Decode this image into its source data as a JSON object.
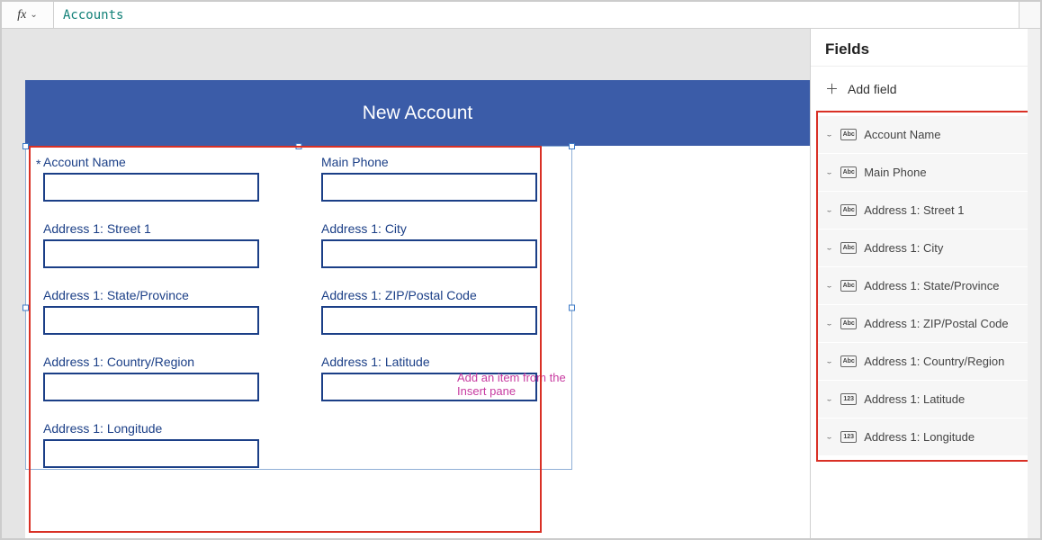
{
  "formula_bar": {
    "fx_label": "fx",
    "value": "Accounts"
  },
  "canvas": {
    "title": "New Account",
    "required_mark": "*",
    "placeholder_hint": "Add an item from the Insert pane",
    "fields": [
      {
        "label": "Account Name"
      },
      {
        "label": "Main Phone"
      },
      {
        "label": "Address 1: Street 1"
      },
      {
        "label": "Address 1: City"
      },
      {
        "label": "Address 1: State/Province"
      },
      {
        "label": "Address 1: ZIP/Postal Code"
      },
      {
        "label": "Address 1: Country/Region"
      },
      {
        "label": "Address 1: Latitude"
      },
      {
        "label": "Address 1: Longitude"
      }
    ]
  },
  "panel": {
    "header": "Fields",
    "add_label": "Add field",
    "items": [
      {
        "type": "Abc",
        "label": "Account Name"
      },
      {
        "type": "Abc",
        "label": "Main Phone"
      },
      {
        "type": "Abc",
        "label": "Address 1: Street 1"
      },
      {
        "type": "Abc",
        "label": "Address 1: City"
      },
      {
        "type": "Abc",
        "label": "Address 1: State/Province"
      },
      {
        "type": "Abc",
        "label": "Address 1: ZIP/Postal Code"
      },
      {
        "type": "Abc",
        "label": "Address 1: Country/Region"
      },
      {
        "type": "123",
        "label": "Address 1: Latitude"
      },
      {
        "type": "123",
        "label": "Address 1: Longitude"
      }
    ]
  }
}
